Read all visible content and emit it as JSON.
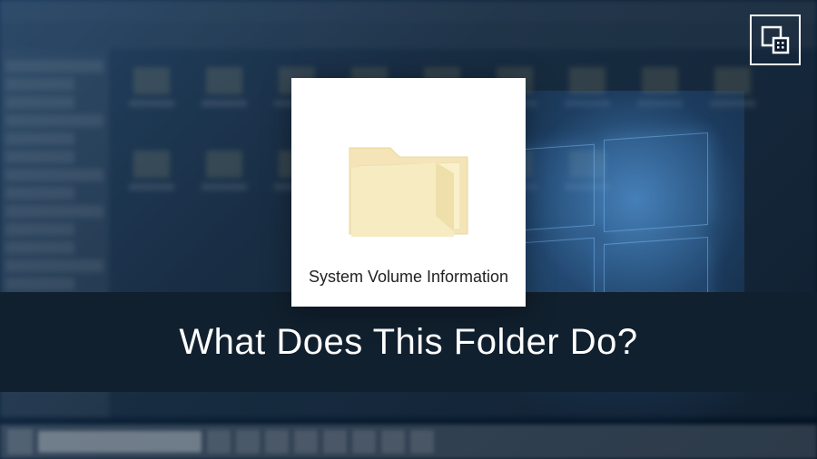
{
  "card": {
    "folder_label": "System Volume Information"
  },
  "headline": {
    "text": "What Does This Folder Do?"
  },
  "brand": {
    "icon_name": "fossbytes-logo"
  },
  "background": {
    "os_hint": "Windows 10",
    "explorer_visible": true
  }
}
